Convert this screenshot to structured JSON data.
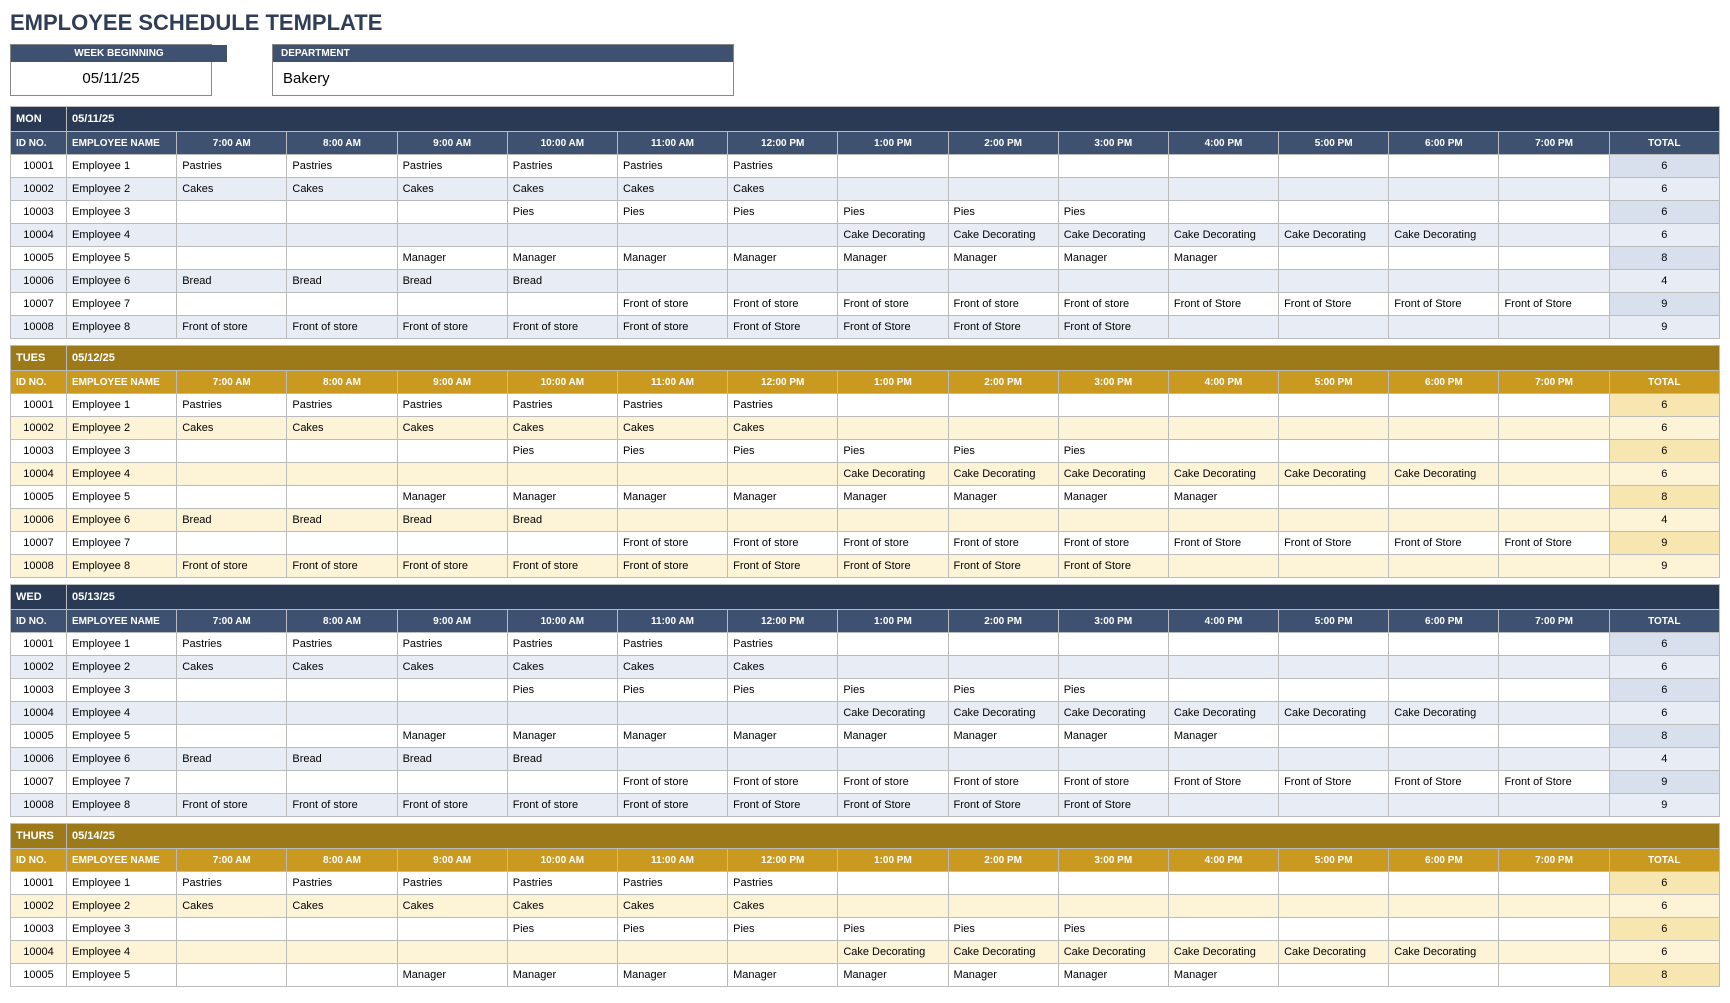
{
  "title": "EMPLOYEE SCHEDULE TEMPLATE",
  "week_label": "WEEK BEGINNING",
  "week_val": "05/11/25",
  "dept_label": "DEPARTMENT",
  "dept_val": "Bakery",
  "cols": [
    "ID NO.",
    "EMPLOYEE NAME",
    "7:00 AM",
    "8:00 AM",
    "9:00 AM",
    "10:00 AM",
    "11:00 AM",
    "12:00 PM",
    "1:00 PM",
    "2:00 PM",
    "3:00 PM",
    "4:00 PM",
    "5:00 PM",
    "6:00 PM",
    "7:00 PM",
    "TOTAL"
  ],
  "rows": [
    {
      "id": "10001",
      "name": "Employee 1",
      "h": [
        "Pastries",
        "Pastries",
        "Pastries",
        "Pastries",
        "Pastries",
        "Pastries",
        "",
        "",
        "",
        "",
        "",
        "",
        ""
      ],
      "t": "6"
    },
    {
      "id": "10002",
      "name": "Employee 2",
      "h": [
        "Cakes",
        "Cakes",
        "Cakes",
        "Cakes",
        "Cakes",
        "Cakes",
        "",
        "",
        "",
        "",
        "",
        "",
        ""
      ],
      "t": "6"
    },
    {
      "id": "10003",
      "name": "Employee 3",
      "h": [
        "",
        "",
        "",
        "Pies",
        "Pies",
        "Pies",
        "Pies",
        "Pies",
        "Pies",
        "",
        "",
        "",
        ""
      ],
      "t": "6"
    },
    {
      "id": "10004",
      "name": "Employee 4",
      "h": [
        "",
        "",
        "",
        "",
        "",
        "",
        "Cake Decorating",
        "Cake Decorating",
        "Cake Decorating",
        "Cake Decorating",
        "Cake Decorating",
        "Cake Decorating",
        ""
      ],
      "t": "6"
    },
    {
      "id": "10005",
      "name": "Employee 5",
      "h": [
        "",
        "",
        "Manager",
        "Manager",
        "Manager",
        "Manager",
        "Manager",
        "Manager",
        "Manager",
        "Manager",
        "",
        "",
        ""
      ],
      "t": "8"
    },
    {
      "id": "10006",
      "name": "Employee 6",
      "h": [
        "Bread",
        "Bread",
        "Bread",
        "Bread",
        "",
        "",
        "",
        "",
        "",
        "",
        "",
        "",
        ""
      ],
      "t": "4"
    },
    {
      "id": "10007",
      "name": "Employee 7",
      "h": [
        "",
        "",
        "",
        "",
        "Front of store",
        "Front of store",
        "Front of store",
        "Front of store",
        "Front of store",
        "Front of Store",
        "Front of Store",
        "Front of Store",
        "Front of Store"
      ],
      "t": "9"
    },
    {
      "id": "10008",
      "name": "Employee 8",
      "h": [
        "Front of store",
        "Front of store",
        "Front of store",
        "Front of store",
        "Front of store",
        "Front of Store",
        "Front of Store",
        "Front of Store",
        "Front of Store",
        "",
        "",
        "",
        ""
      ],
      "t": "9"
    }
  ],
  "days": [
    {
      "name": "MON",
      "date": "05/11/25",
      "theme": "blue",
      "count": 8
    },
    {
      "name": "TUES",
      "date": "05/12/25",
      "theme": "gold",
      "count": 8
    },
    {
      "name": "WED",
      "date": "05/13/25",
      "theme": "blue",
      "count": 8
    },
    {
      "name": "THURS",
      "date": "05/14/25",
      "theme": "gold",
      "count": 5
    }
  ]
}
